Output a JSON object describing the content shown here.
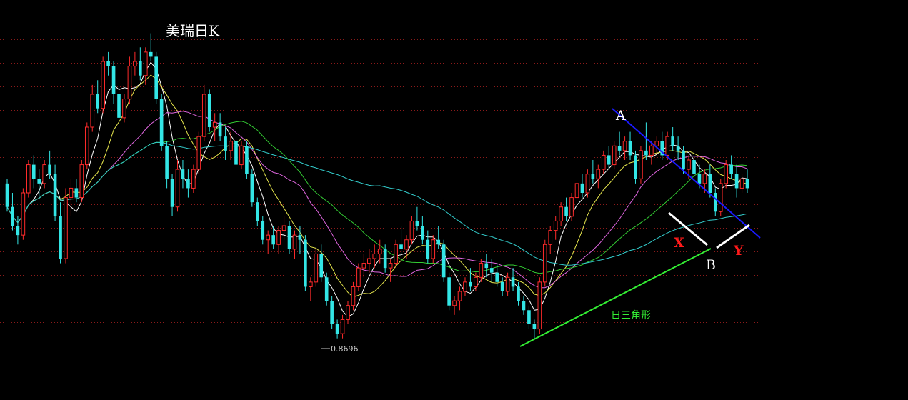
{
  "chart_data": {
    "type": "candlestick",
    "title": "美瑞日K",
    "ylim": [
      0.85,
      1.2
    ],
    "grid": true,
    "grid_style": "dotted-red",
    "colors": {
      "background": "#000000",
      "up": "#ff2a2a",
      "down": "#33e6e6",
      "grid": "#8b1a1a",
      "ma5": "#ffffff",
      "ma10": "#e6e64d",
      "ma20": "#e066e0",
      "ma30": "#33cc33",
      "ma60": "#33cccc",
      "trend_blue": "#1a1aff",
      "triangle_green": "#33ee33"
    },
    "low_marker": "0.8696",
    "annotations": {
      "point_a": "A",
      "point_b": "B",
      "point_x": "X",
      "point_y": "Y",
      "triangle_label": "日三角形"
    },
    "candles": [
      [
        1.035,
        1.04,
        1.005,
        1.01
      ],
      [
        1.01,
        1.025,
        0.985,
        0.99
      ],
      [
        0.99,
        1.0,
        0.97,
        0.98
      ],
      [
        0.98,
        1.03,
        0.975,
        1.025
      ],
      [
        1.025,
        1.06,
        1.02,
        1.055
      ],
      [
        1.055,
        1.065,
        1.03,
        1.04
      ],
      [
        1.04,
        1.05,
        1.02,
        1.035
      ],
      [
        1.035,
        1.06,
        1.03,
        1.055
      ],
      [
        1.055,
        1.07,
        1.04,
        1.045
      ],
      [
        1.045,
        1.055,
        0.995,
        1.0
      ],
      [
        1.0,
        1.015,
        0.95,
        0.955
      ],
      [
        0.955,
        1.03,
        0.95,
        1.02
      ],
      [
        1.02,
        1.04,
        1.0,
        1.03
      ],
      [
        1.03,
        1.04,
        1.015,
        1.02
      ],
      [
        1.02,
        1.06,
        1.015,
        1.055
      ],
      [
        1.055,
        1.1,
        1.05,
        1.095
      ],
      [
        1.095,
        1.14,
        1.09,
        1.13
      ],
      [
        1.13,
        1.145,
        1.11,
        1.115
      ],
      [
        1.115,
        1.17,
        1.11,
        1.165
      ],
      [
        1.165,
        1.175,
        1.15,
        1.16
      ],
      [
        1.16,
        1.165,
        1.12,
        1.13
      ],
      [
        1.13,
        1.14,
        1.1,
        1.105
      ],
      [
        1.105,
        1.13,
        1.1,
        1.125
      ],
      [
        1.125,
        1.17,
        1.12,
        1.16
      ],
      [
        1.16,
        1.175,
        1.15,
        1.165
      ],
      [
        1.165,
        1.18,
        1.145,
        1.15
      ],
      [
        1.15,
        1.18,
        1.14,
        1.175
      ],
      [
        1.175,
        1.195,
        1.165,
        1.17
      ],
      [
        1.17,
        1.175,
        1.12,
        1.125
      ],
      [
        1.125,
        1.13,
        1.07,
        1.075
      ],
      [
        1.075,
        1.08,
        1.03,
        1.04
      ],
      [
        1.04,
        1.045,
        1.0,
        1.01
      ],
      [
        1.01,
        1.06,
        1.005,
        1.05
      ],
      [
        1.05,
        1.06,
        1.03,
        1.04
      ],
      [
        1.04,
        1.05,
        1.02,
        1.03
      ],
      [
        1.03,
        1.055,
        1.025,
        1.05
      ],
      [
        1.05,
        1.09,
        1.045,
        1.085
      ],
      [
        1.085,
        1.14,
        1.08,
        1.13
      ],
      [
        1.13,
        1.135,
        1.09,
        1.095
      ],
      [
        1.095,
        1.11,
        1.08,
        1.1
      ],
      [
        1.1,
        1.11,
        1.08,
        1.085
      ],
      [
        1.085,
        1.095,
        1.06,
        1.07
      ],
      [
        1.07,
        1.09,
        1.06,
        1.08
      ],
      [
        1.08,
        1.085,
        1.05,
        1.055
      ],
      [
        1.055,
        1.08,
        1.05,
        1.075
      ],
      [
        1.075,
        1.08,
        1.04,
        1.045
      ],
      [
        1.045,
        1.05,
        1.01,
        1.015
      ],
      [
        1.015,
        1.02,
        0.99,
        0.995
      ],
      [
        0.995,
        1.0,
        0.97,
        0.975
      ],
      [
        0.975,
        0.985,
        0.96,
        0.98
      ],
      [
        0.98,
        0.99,
        0.965,
        0.97
      ],
      [
        0.97,
        0.99,
        0.96,
        0.985
      ],
      [
        0.985,
        1.0,
        0.975,
        0.99
      ],
      [
        0.99,
        0.995,
        0.96,
        0.965
      ],
      [
        0.965,
        0.985,
        0.955,
        0.98
      ],
      [
        0.98,
        0.99,
        0.96,
        0.975
      ],
      [
        0.975,
        0.98,
        0.92,
        0.925
      ],
      [
        0.925,
        0.935,
        0.91,
        0.93
      ],
      [
        0.93,
        0.965,
        0.925,
        0.96
      ],
      [
        0.96,
        0.97,
        0.93,
        0.935
      ],
      [
        0.935,
        0.94,
        0.905,
        0.91
      ],
      [
        0.91,
        0.915,
        0.88,
        0.885
      ],
      [
        0.885,
        0.89,
        0.87,
        0.875
      ],
      [
        0.875,
        0.895,
        0.87,
        0.89
      ],
      [
        0.89,
        0.91,
        0.885,
        0.905
      ],
      [
        0.905,
        0.93,
        0.9,
        0.925
      ],
      [
        0.925,
        0.95,
        0.92,
        0.945
      ],
      [
        0.945,
        0.96,
        0.935,
        0.95
      ],
      [
        0.95,
        0.965,
        0.94,
        0.955
      ],
      [
        0.955,
        0.97,
        0.945,
        0.96
      ],
      [
        0.96,
        0.975,
        0.95,
        0.965
      ],
      [
        0.965,
        0.97,
        0.94,
        0.945
      ],
      [
        0.945,
        0.955,
        0.93,
        0.95
      ],
      [
        0.95,
        0.975,
        0.945,
        0.97
      ],
      [
        0.97,
        0.99,
        0.96,
        0.965
      ],
      [
        0.965,
        0.98,
        0.955,
        0.975
      ],
      [
        0.975,
        1.0,
        0.97,
        0.995
      ],
      [
        0.995,
        1.01,
        0.985,
        0.99
      ],
      [
        0.99,
        1.0,
        0.97,
        0.975
      ],
      [
        0.975,
        0.985,
        0.95,
        0.955
      ],
      [
        0.955,
        0.98,
        0.95,
        0.975
      ],
      [
        0.975,
        0.99,
        0.965,
        0.97
      ],
      [
        0.97,
        0.975,
        0.93,
        0.935
      ],
      [
        0.935,
        0.94,
        0.9,
        0.905
      ],
      [
        0.905,
        0.915,
        0.895,
        0.91
      ],
      [
        0.91,
        0.925,
        0.9,
        0.92
      ],
      [
        0.92,
        0.935,
        0.915,
        0.93
      ],
      [
        0.93,
        0.945,
        0.92,
        0.925
      ],
      [
        0.925,
        0.94,
        0.92,
        0.935
      ],
      [
        0.935,
        0.955,
        0.93,
        0.95
      ],
      [
        0.95,
        0.96,
        0.935,
        0.945
      ],
      [
        0.945,
        0.955,
        0.93,
        0.94
      ],
      [
        0.94,
        0.95,
        0.925,
        0.93
      ],
      [
        0.93,
        0.935,
        0.915,
        0.92
      ],
      [
        0.92,
        0.94,
        0.915,
        0.935
      ],
      [
        0.935,
        0.945,
        0.92,
        0.925
      ],
      [
        0.925,
        0.93,
        0.905,
        0.91
      ],
      [
        0.91,
        0.915,
        0.895,
        0.9
      ],
      [
        0.9,
        0.905,
        0.88,
        0.885
      ],
      [
        0.885,
        0.89,
        0.87,
        0.88
      ],
      [
        0.88,
        0.935,
        0.875,
        0.93
      ],
      [
        0.93,
        0.975,
        0.925,
        0.97
      ],
      [
        0.97,
        0.99,
        0.96,
        0.985
      ],
      [
        0.985,
        1.0,
        0.975,
        0.995
      ],
      [
        0.995,
        1.015,
        0.99,
        1.01
      ],
      [
        1.01,
        1.02,
        0.995,
        1.0
      ],
      [
        1.0,
        1.025,
        0.995,
        1.02
      ],
      [
        1.02,
        1.04,
        1.01,
        1.035
      ],
      [
        1.035,
        1.045,
        1.02,
        1.025
      ],
      [
        1.025,
        1.05,
        1.02,
        1.045
      ],
      [
        1.045,
        1.06,
        1.035,
        1.04
      ],
      [
        1.04,
        1.055,
        1.03,
        1.05
      ],
      [
        1.05,
        1.07,
        1.045,
        1.065
      ],
      [
        1.065,
        1.075,
        1.05,
        1.055
      ],
      [
        1.055,
        1.08,
        1.05,
        1.075
      ],
      [
        1.075,
        1.09,
        1.065,
        1.07
      ],
      [
        1.07,
        1.085,
        1.06,
        1.08
      ],
      [
        1.08,
        1.09,
        1.06,
        1.065
      ],
      [
        1.065,
        1.07,
        1.035,
        1.04
      ],
      [
        1.04,
        1.075,
        1.035,
        1.07
      ],
      [
        1.07,
        1.1,
        1.06,
        1.065
      ],
      [
        1.065,
        1.08,
        1.055,
        1.075
      ],
      [
        1.075,
        1.085,
        1.065,
        1.08
      ],
      [
        1.08,
        1.09,
        1.06,
        1.065
      ],
      [
        1.065,
        1.09,
        1.06,
        1.085
      ],
      [
        1.085,
        1.095,
        1.07,
        1.075
      ],
      [
        1.075,
        1.085,
        1.06,
        1.07
      ],
      [
        1.07,
        1.075,
        1.045,
        1.05
      ],
      [
        1.05,
        1.065,
        1.04,
        1.06
      ],
      [
        1.06,
        1.07,
        1.04,
        1.045
      ],
      [
        1.045,
        1.055,
        1.03,
        1.035
      ],
      [
        1.035,
        1.05,
        1.025,
        1.045
      ],
      [
        1.045,
        1.055,
        1.02,
        1.025
      ],
      [
        1.025,
        1.03,
        1.0,
        1.005
      ],
      [
        1.005,
        1.04,
        1.0,
        1.035
      ],
      [
        1.035,
        1.06,
        1.03,
        1.055
      ],
      [
        1.055,
        1.065,
        1.04,
        1.045
      ],
      [
        1.045,
        1.055,
        1.02,
        1.03
      ],
      [
        1.03,
        1.045,
        1.025,
        1.04
      ],
      [
        1.04,
        1.05,
        1.025,
        1.03
      ]
    ]
  }
}
